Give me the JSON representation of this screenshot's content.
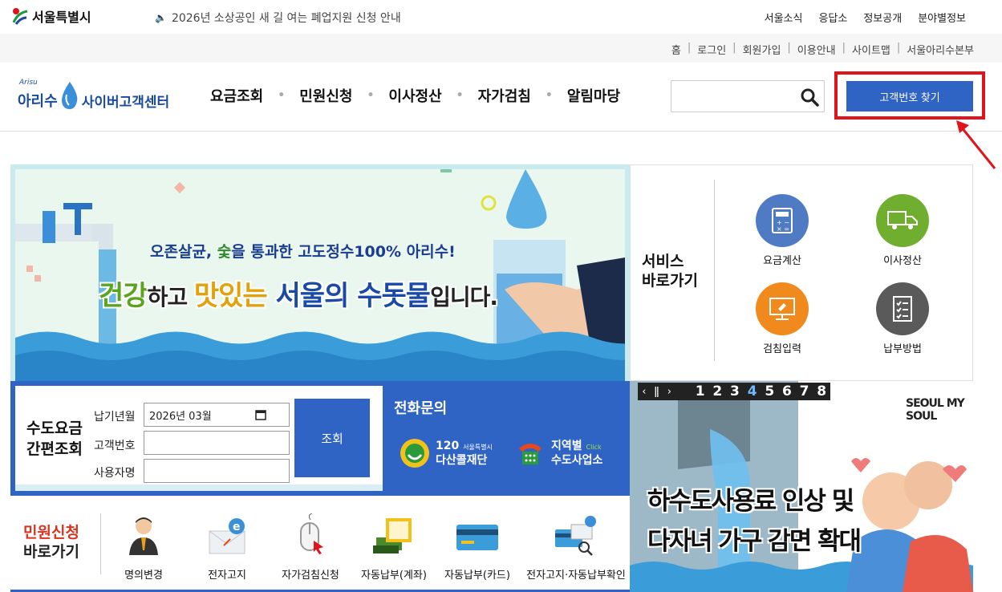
{
  "topbar": {
    "seoul_logo": "서울특별시",
    "notice": "2026년 소상공인 새 길 여는 폐업지원 신청 안내",
    "links": [
      "서울소식",
      "응답소",
      "정보공개",
      "분야별정보"
    ]
  },
  "utilbar": {
    "links": [
      "홈",
      "로그인",
      "회원가입",
      "이용안내",
      "사이트맵",
      "서울아리수본부"
    ]
  },
  "header": {
    "logo_small": "Arisu",
    "logo_name": "아리수",
    "logo_center": "사이버고객센터",
    "nav": [
      "요금조회",
      "민원신청",
      "이사정산",
      "자가검침",
      "알림마당"
    ],
    "search_placeholder": "",
    "find_customer_button": "고객번호 찾기"
  },
  "banner": {
    "subtitle_parts": [
      "오존살균, ",
      "숯",
      "을 통과한 고도정수100% 아리수",
      "!"
    ],
    "main_parts": [
      "건강",
      "하고 ",
      "맛있는",
      " ",
      "서울의 수돗물",
      "입니다."
    ]
  },
  "services": {
    "title_line1": "서비스",
    "title_line2": "바로가기",
    "items": [
      {
        "label": "요금계산",
        "icon": "calculator-icon",
        "color": "#4f7bc4"
      },
      {
        "label": "이사정산",
        "icon": "truck-icon",
        "color": "#6fae2f"
      },
      {
        "label": "검침입력",
        "icon": "monitor-icon",
        "color": "#f08a1c"
      },
      {
        "label": "납부방법",
        "icon": "checklist-icon",
        "color": "#5a5a5a"
      }
    ]
  },
  "lookup": {
    "title_line1": "수도요금",
    "title_line2": "간편조회",
    "fields": [
      {
        "label": "납기년월",
        "value": "2026년 03월"
      },
      {
        "label": "고객번호",
        "value": ""
      },
      {
        "label": "사용자명",
        "value": ""
      }
    ],
    "button": "조회"
  },
  "phone": {
    "title": "전화문의",
    "items": [
      {
        "small": "서울특별시",
        "num": "120",
        "name": "다산콜재단"
      },
      {
        "small": "Click",
        "num": "지역별",
        "name": "수도사업소"
      }
    ]
  },
  "civil": {
    "title_line1": "민원신청",
    "title_line2": "바로가기",
    "items": [
      "명의변경",
      "전자고지",
      "자가검침신청",
      "자동납부(계좌)",
      "자동납부(카드)",
      "전자고지·자동납부확인"
    ]
  },
  "promo": {
    "slides": [
      "1",
      "2",
      "3",
      "4",
      "5",
      "6",
      "7",
      "8"
    ],
    "active_slide": "4",
    "brand": "SEOUL MY SOUL",
    "line1": "하수도사용료 인상 및",
    "line2": "다자녀 가구 감면 확대"
  }
}
